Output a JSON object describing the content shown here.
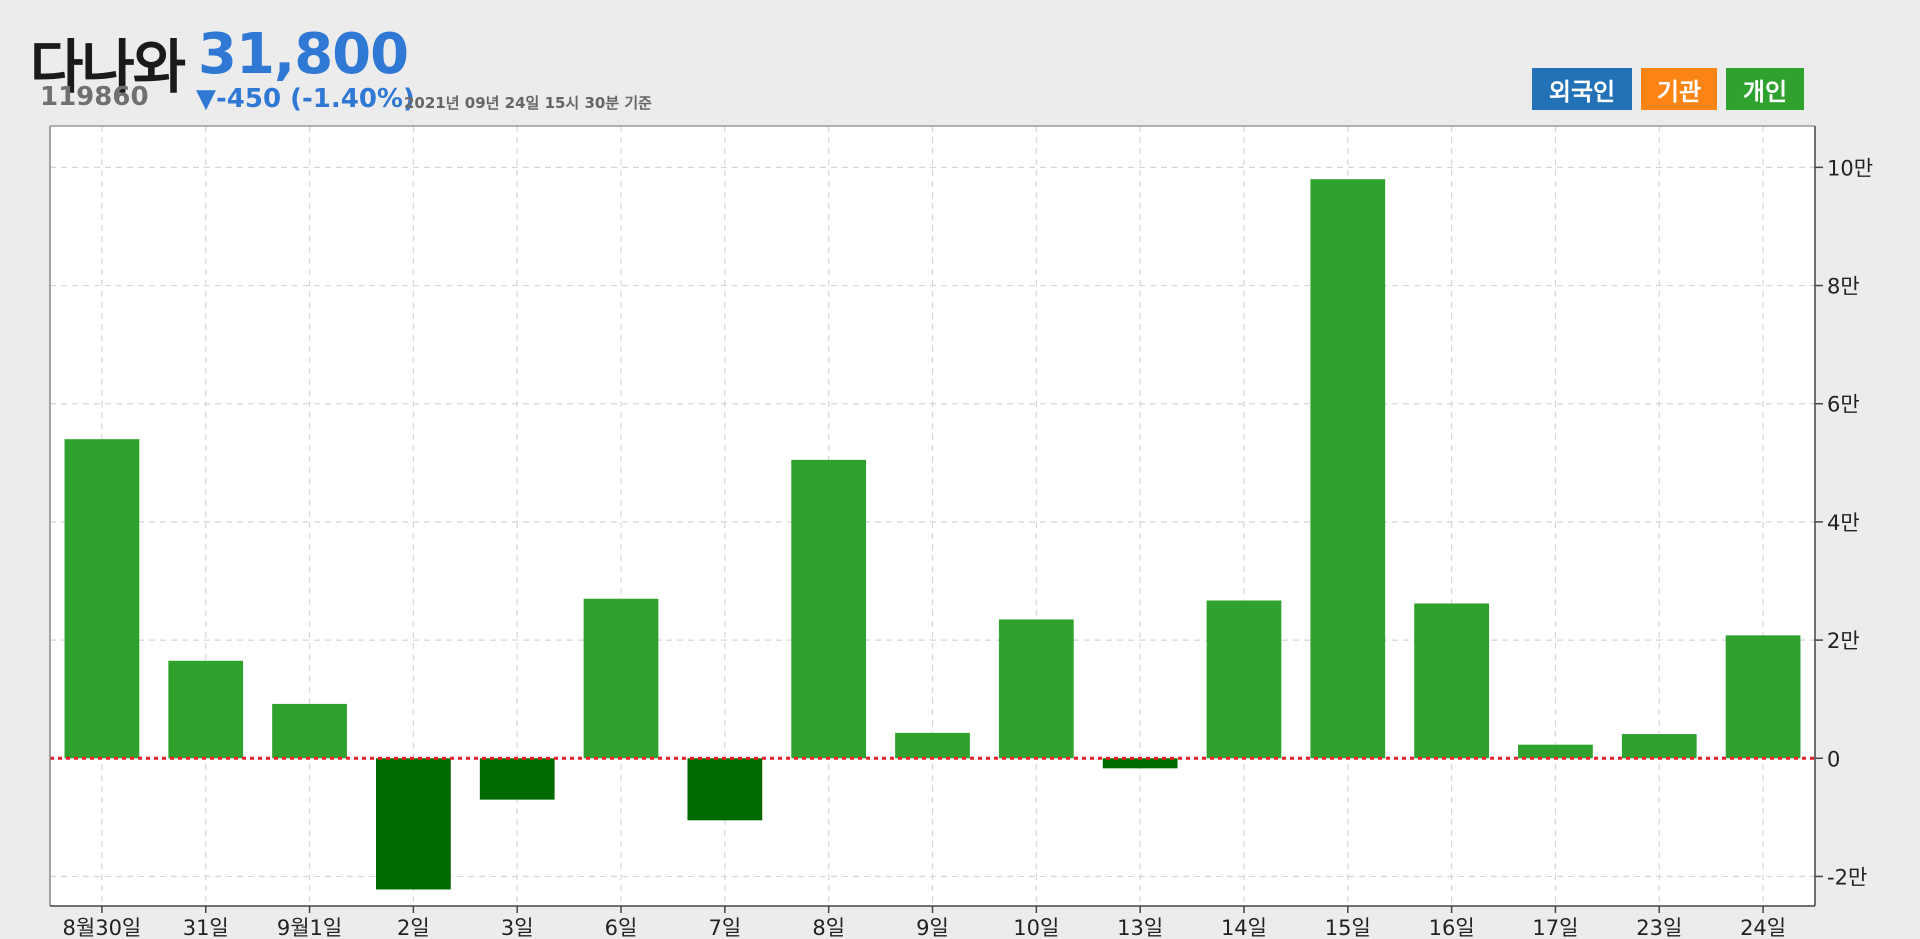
{
  "header": {
    "stock_name": "다나와",
    "stock_price": "31,800",
    "stock_code": "119860",
    "change": "▼-450 (-1.40%)",
    "as_of": "2021년 09년 24일 15시 30분 기준"
  },
  "investor_buttons": [
    {
      "label": "외국인",
      "color": "#2372b8"
    },
    {
      "label": "기관",
      "color": "#fb8415"
    },
    {
      "label": "개인",
      "color": "#2ea22d"
    }
  ],
  "colors": {
    "positive_bar": "#2ea22d",
    "negative_bar": "#006a00",
    "zero_line": "#e8202a",
    "grid": "#d6d6d6"
  },
  "chart_data": {
    "type": "bar",
    "categories": [
      "8월30일",
      "31일",
      "9월1일",
      "2일",
      "3일",
      "6일",
      "7일",
      "8일",
      "9일",
      "10일",
      "13일",
      "14일",
      "15일",
      "16일",
      "17일",
      "23일",
      "24일"
    ],
    "values": [
      54000,
      16500,
      9200,
      -22200,
      -7000,
      27000,
      -10500,
      50500,
      4300,
      23500,
      -1700,
      26700,
      98000,
      26200,
      2300,
      4100,
      20800
    ],
    "ylim": [
      -25000,
      107000
    ],
    "yticks": [
      -20000,
      0,
      20000,
      40000,
      60000,
      80000,
      100000
    ],
    "ytick_labels": [
      "-2만",
      "0",
      "2만",
      "4만",
      "6만",
      "8만",
      "10만"
    ],
    "y_axis_side": "right",
    "grid": true,
    "zero_line": "dotted"
  }
}
